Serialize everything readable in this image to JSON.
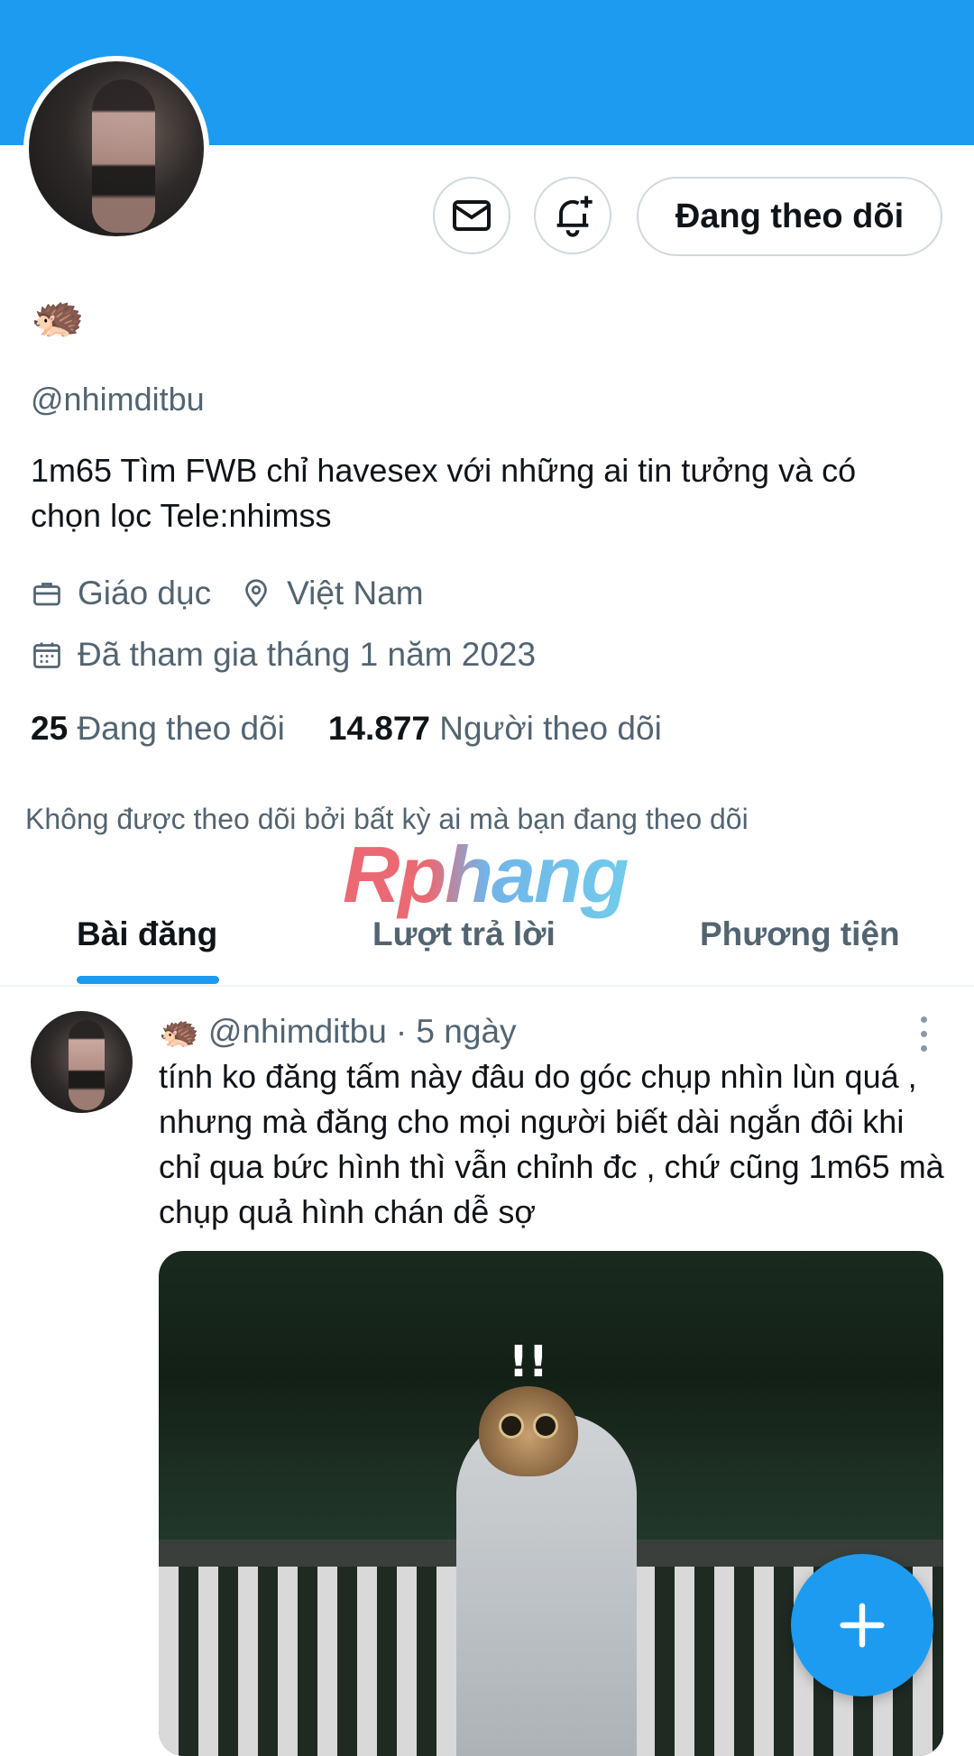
{
  "profile": {
    "display_name_emoji": "🦔",
    "handle": "@nhimditbu",
    "bio": "1m65 Tìm FWB chỉ havesex với những ai tin tưởng và có chọn lọc Tele:nhimss",
    "category": "Giáo dục",
    "location": "Việt Nam",
    "joined": "Đã tham gia tháng 1 năm 2023",
    "following_count": "25",
    "following_label": "Đang theo dõi",
    "followers_count": "14.877",
    "followers_label": "Người theo dõi",
    "not_followed_note": "Không được theo dõi bởi bất kỳ ai mà bạn đang theo dõi"
  },
  "actions": {
    "follow_state_label": "Đang theo dõi",
    "message_icon": "mail-icon",
    "notify_icon": "bell-plus-icon"
  },
  "watermark": "Rphang",
  "tabs": [
    {
      "label": "Bài đăng",
      "active": true
    },
    {
      "label": "Lượt trả lời",
      "active": false
    },
    {
      "label": "Phương tiện",
      "active": false
    }
  ],
  "post": {
    "author_emoji": "🦔",
    "author_handle": "@nhimditbu",
    "time": "· 5 ngày",
    "text": "tính ko đăng tấm này đâu do góc chụp nhìn lùn quá , nhưng mà đăng cho mọi người biết dài ngắn đôi khi chỉ qua bức hình thì vẫn chỉnh đc , chứ cũng 1m65 mà chụp quả hình chán dễ sợ",
    "media_overlay": "!!"
  },
  "colors": {
    "accent": "#1d9bf0",
    "text_primary": "#0f1419",
    "text_secondary": "#536471",
    "border": "#cfd9de"
  }
}
